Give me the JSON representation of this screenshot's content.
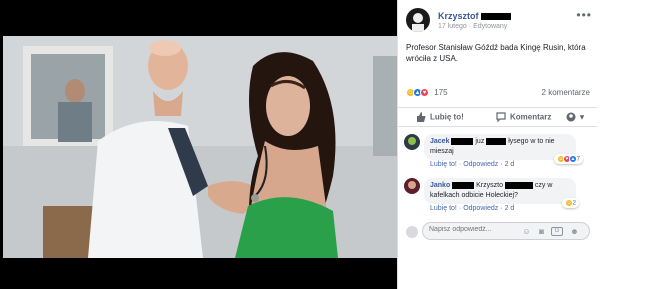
{
  "post": {
    "author": "Krzysztof",
    "date": "17 lutego",
    "edited": "Edytowany",
    "text": "Profesor Stanisław Góźdź bada Kingę Rusin, która wróciła z USA.",
    "reaction_count": "175",
    "comments_count": "2 komentarze"
  },
  "actions": {
    "like": "Lubię to!",
    "comment": "Komentarz"
  },
  "comments": [
    {
      "name": "Jacek",
      "text_a": "juz",
      "text_b": "łysego w to nie mieszaj",
      "like": "Lubię to!",
      "reply": "Odpowiedz",
      "time": "2 d",
      "reactions": "7"
    },
    {
      "name": "Janko",
      "text_a": "Krzyszto",
      "text_b": "czy w kafelkach odbicie Holeckiej?",
      "like": "Lubię to!",
      "reply": "Odpowiedz",
      "time": "2 d",
      "reactions": "2"
    }
  ],
  "reply_box": {
    "placeholder": "Napisz odpowiedź..."
  },
  "icons": {
    "more": "more-dots-icon",
    "like": "thumbs-up-icon",
    "comment": "speech-bubble-icon",
    "share": "share-avatar-icon",
    "emoji": "emoji-icon",
    "camera": "camera-icon",
    "gif": "gif-icon",
    "sticker": "sticker-icon"
  },
  "colors": {
    "link": "#385898",
    "accent": "#4267b2",
    "haha": "#f7b928",
    "like": "#1877f2",
    "love": "#f33e58"
  }
}
